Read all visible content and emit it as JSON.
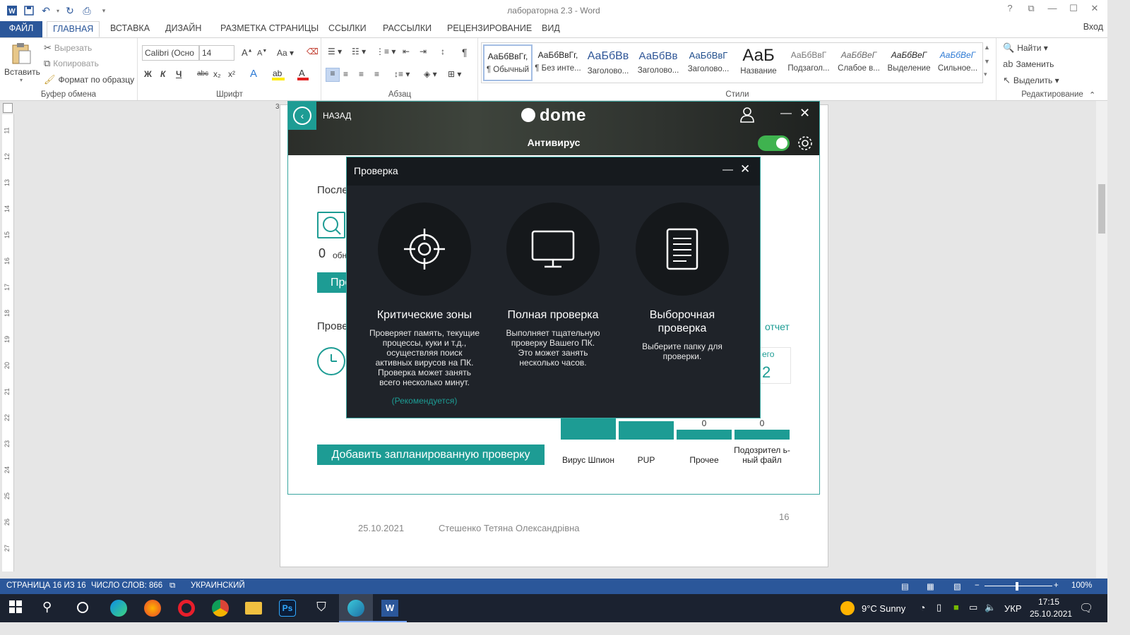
{
  "window": {
    "title": "лабораторна 2.3 - Word",
    "signin": "Вход"
  },
  "qat": {
    "save_icon": "save-icon",
    "undo_icon": "undo-icon",
    "redo_icon": "redo-icon"
  },
  "tabs": [
    "ФАЙЛ",
    "ГЛАВНАЯ",
    "ВСТАВКА",
    "ДИЗАЙН",
    "РАЗМЕТКА СТРАНИЦЫ",
    "ССЫЛКИ",
    "РАССЫЛКИ",
    "РЕЦЕНЗИРОВАНИЕ",
    "ВИД"
  ],
  "ribbon": {
    "clipboard": {
      "paste": "Вставить",
      "cut": "Вырезать",
      "copy": "Копировать",
      "format_painter": "Формат по образцу",
      "label": "Буфер обмена"
    },
    "font": {
      "name": "Calibri (Осно",
      "size": "14",
      "label": "Шрифт",
      "bold": "Ж",
      "italic": "К",
      "underline": "Ч",
      "strike": "abc",
      "sub": "x₂",
      "sup": "x²",
      "grow": "A",
      "shrink": "A",
      "case": "Aa"
    },
    "paragraph": {
      "label": "Абзац",
      "pilcrow": "¶"
    },
    "styles": {
      "label": "Стили",
      "items": [
        {
          "sample": "АаБбВвГг,",
          "name": "¶ Обычный"
        },
        {
          "sample": "АаБбВвГг,",
          "name": "¶ Без инте..."
        },
        {
          "sample": "АаБбВв",
          "name": "Заголово..."
        },
        {
          "sample": "АаБбВв",
          "name": "Заголово..."
        },
        {
          "sample": "АаБбВвГ",
          "name": "Заголово..."
        },
        {
          "sample": "АаБ",
          "name": "Название"
        },
        {
          "sample": "АаБбВвГ",
          "name": "Подзагол..."
        },
        {
          "sample": "АаБбВеГ",
          "name": "Слабое в..."
        },
        {
          "sample": "АаБбВеГ",
          "name": "Выделение"
        },
        {
          "sample": "АаБбВеГ",
          "name": "Сильное..."
        }
      ]
    },
    "editing": {
      "find": "Найти",
      "replace": "Заменить",
      "select": "Выделить",
      "label": "Редактирование"
    }
  },
  "ruler": {
    "hstart": "3",
    "vmarks": [
      "11",
      "12",
      "13",
      "14",
      "15",
      "16",
      "17",
      "18",
      "19",
      "20",
      "21",
      "22",
      "23",
      "24",
      "25",
      "26",
      "27"
    ]
  },
  "document": {
    "footer_date": "25.10.2021",
    "footer_name": "Стешенко Тетяна Олександрівна",
    "page_number": "16"
  },
  "dome": {
    "back": "НАЗАД",
    "logo": "dome",
    "section": "Антивирус",
    "protection_on": true,
    "last_label": "После",
    "detected_count": "0",
    "detected_text": "обн",
    "scan_btn": "Про",
    "scheduled_label": "Прове",
    "report_link": "отчет",
    "stat_label": "его",
    "stat_value": "2",
    "add_scheduled_btn": "Добавить запланированную проверку",
    "chart_data": {
      "type": "bar",
      "categories": [
        "Вирус Шпион",
        "PUP",
        "Прочее",
        "Подозрител ь- ный файл"
      ],
      "values": [
        null,
        null,
        0,
        0
      ],
      "value_labels": [
        "",
        "",
        "0",
        "0"
      ]
    }
  },
  "scan": {
    "title": "Проверка",
    "options": [
      {
        "icon": "crosshair-icon",
        "title": "Критические зоны",
        "desc": "Проверяет память, текущие процессы, куки и т.д., осуществляя поиск активных вирусов на ПК. Проверка может занять всего несколько минут.",
        "note": "(Рекомендуется)"
      },
      {
        "icon": "monitor-icon",
        "title": "Полная проверка",
        "desc": "Выполняет тщательную проверку Вашего ПК. Это может занять несколько часов.",
        "note": ""
      },
      {
        "icon": "document-icon",
        "title": "Выборочная проверка",
        "desc": "Выберите папку для проверки.",
        "note": ""
      }
    ]
  },
  "statusbar": {
    "page": "СТРАНИЦА 16 ИЗ 16",
    "words": "ЧИСЛО СЛОВ: 866",
    "language": "УКРАИНСКИЙ",
    "zoom": "100%"
  },
  "taskbar": {
    "weather": "9°C  Sunny",
    "lang": "УКР",
    "time": "17:15",
    "date": "25.10.2021"
  }
}
